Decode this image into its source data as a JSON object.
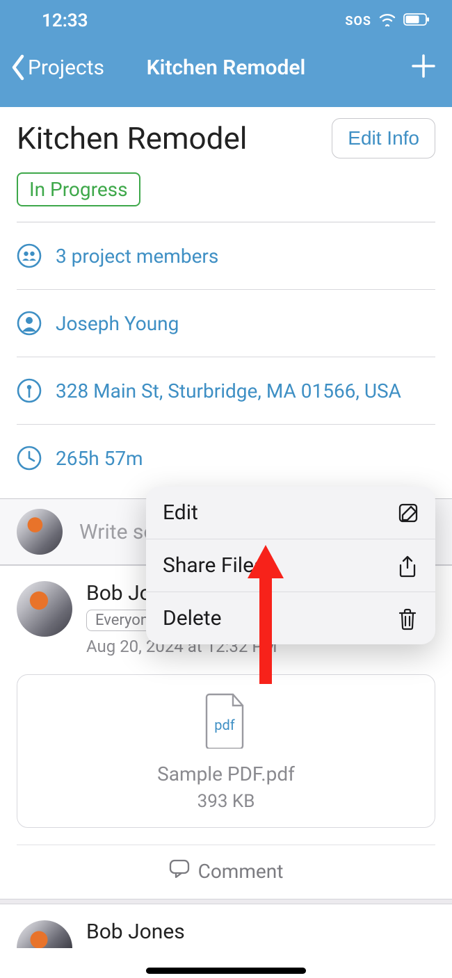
{
  "status_bar": {
    "time": "12:33",
    "sos": "SOS"
  },
  "nav": {
    "back_label": "Projects",
    "title": "Kitchen Remodel"
  },
  "page": {
    "title": "Kitchen Remodel",
    "edit_label": "Edit Info",
    "status": "In Progress"
  },
  "info": {
    "members": "3 project members",
    "owner": "Joseph Young",
    "address": "328 Main St, Sturbridge, MA 01566, USA",
    "time_logged": "265h 57m"
  },
  "compose": {
    "placeholder": "Write so"
  },
  "post": {
    "author": "Bob Jones",
    "audience": "Everyone",
    "timestamp": "Aug 20, 2024 at 12:32 PM",
    "attachment": {
      "badge": "pdf",
      "name": "Sample PDF.pdf",
      "size": "393 KB"
    },
    "comment_label": "Comment"
  },
  "post2": {
    "author": "Bob Jones"
  },
  "menu": {
    "edit": "Edit",
    "share": "Share Files",
    "delete": "Delete"
  }
}
